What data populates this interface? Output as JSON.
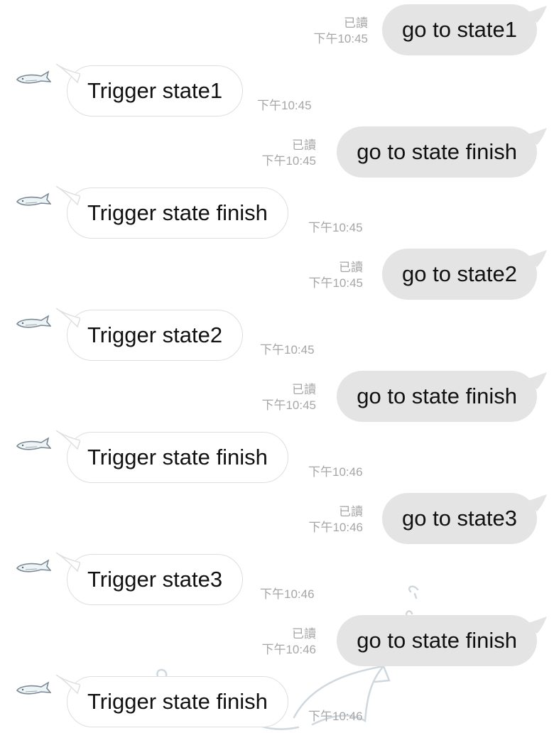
{
  "messages": [
    {
      "direction": "out",
      "text": "go to state1",
      "read_label": "已讀",
      "time": "下午10:45"
    },
    {
      "direction": "in",
      "text": "Trigger state1",
      "time": "下午10:45"
    },
    {
      "direction": "out",
      "text": "go to state finish",
      "read_label": "已讀",
      "time": "下午10:45"
    },
    {
      "direction": "in",
      "text": "Trigger state finish",
      "time": "下午10:45"
    },
    {
      "direction": "out",
      "text": "go to state2",
      "read_label": "已讀",
      "time": "下午10:45"
    },
    {
      "direction": "in",
      "text": "Trigger state2",
      "time": "下午10:45"
    },
    {
      "direction": "out",
      "text": "go to state finish",
      "read_label": "已讀",
      "time": "下午10:45"
    },
    {
      "direction": "in",
      "text": "Trigger state finish",
      "time": "下午10:46"
    },
    {
      "direction": "out",
      "text": "go to state3",
      "read_label": "已讀",
      "time": "下午10:46"
    },
    {
      "direction": "in",
      "text": "Trigger state3",
      "time": "下午10:46"
    },
    {
      "direction": "out",
      "text": "go to state finish",
      "read_label": "已讀",
      "time": "下午10:46"
    },
    {
      "direction": "in",
      "text": "Trigger state finish",
      "time": "下午10:46"
    }
  ],
  "colors": {
    "outgoing_bubble": "#e4e4e4",
    "incoming_bubble": "#ffffff",
    "incoming_border": "#dedede",
    "meta_text": "#a6a6a6",
    "message_text": "#111111"
  },
  "icons": {
    "avatar": "shark-avatar-icon",
    "background": "shark-wallpaper"
  }
}
